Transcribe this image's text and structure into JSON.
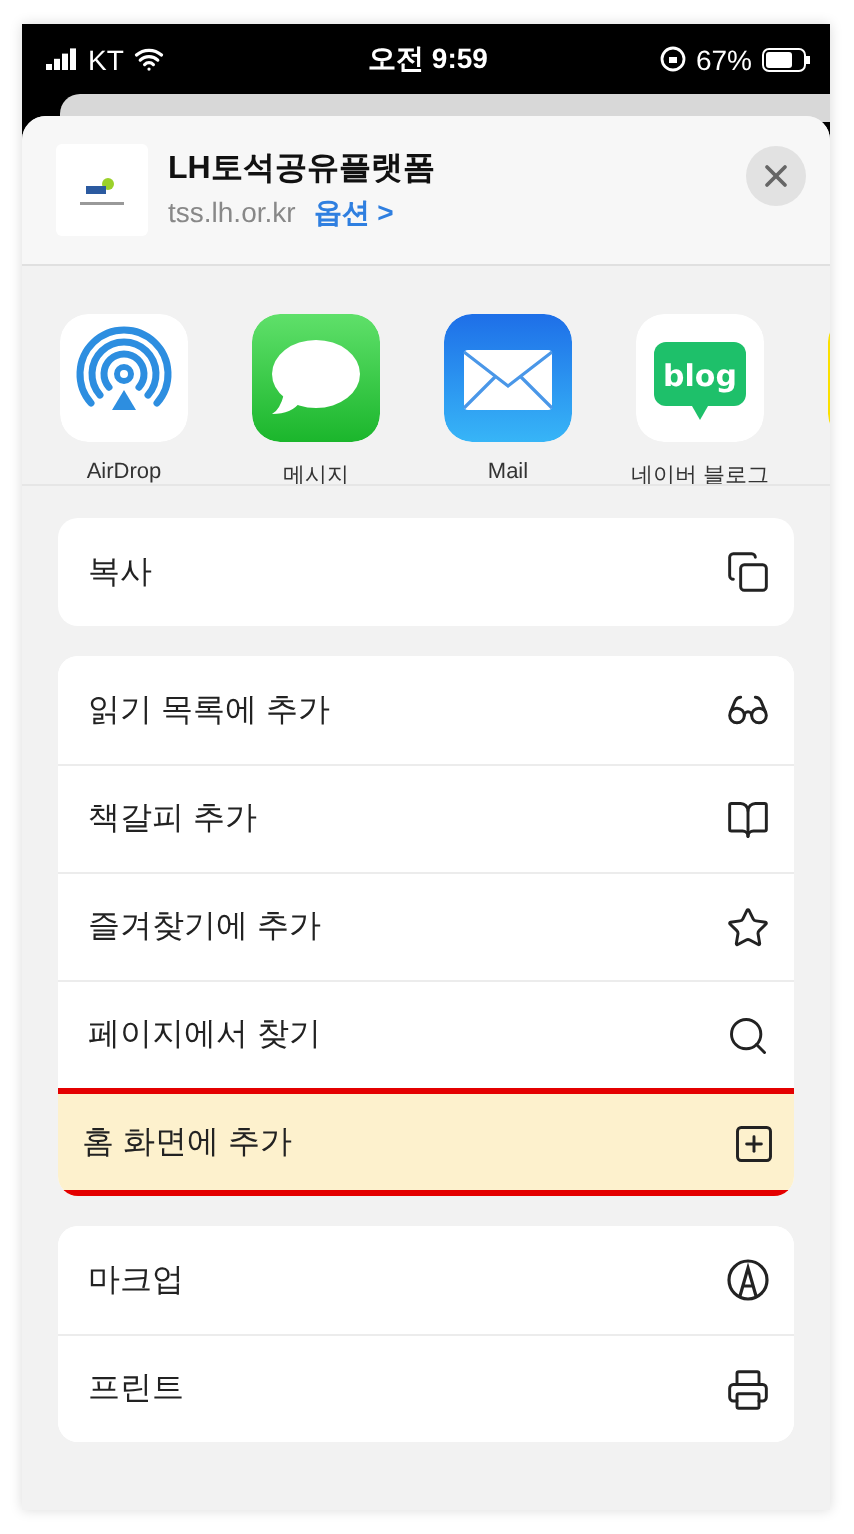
{
  "status_bar": {
    "carrier": "KT",
    "time": "오전 9:59",
    "battery": "67%"
  },
  "header": {
    "title": "LH토석공유플랫폼",
    "url": "tss.lh.or.kr",
    "options_link": "옵션 >"
  },
  "apps": [
    {
      "kind": "airdrop",
      "label": "AirDrop"
    },
    {
      "kind": "messages",
      "label": "메시지"
    },
    {
      "kind": "mail",
      "label": "Mail"
    },
    {
      "kind": "blog",
      "label": "네이버 블로그",
      "icon_text": "blog"
    },
    {
      "kind": "partial"
    }
  ],
  "action_groups": [
    [
      {
        "label": "복사",
        "kind": "copy",
        "highlighted": false
      }
    ],
    [
      {
        "label": "읽기 목록에 추가",
        "kind": "glasses",
        "highlighted": false
      },
      {
        "label": "책갈피 추가",
        "kind": "book",
        "highlighted": false
      },
      {
        "label": "즐겨찾기에 추가",
        "kind": "star",
        "highlighted": false
      },
      {
        "label": "페이지에서 찾기",
        "kind": "search",
        "highlighted": false
      },
      {
        "label": "홈 화면에 추가",
        "kind": "add",
        "highlighted": true
      }
    ],
    [
      {
        "label": "마크업",
        "kind": "markup",
        "highlighted": false
      },
      {
        "label": "프린트",
        "kind": "print",
        "highlighted": false
      }
    ]
  ]
}
